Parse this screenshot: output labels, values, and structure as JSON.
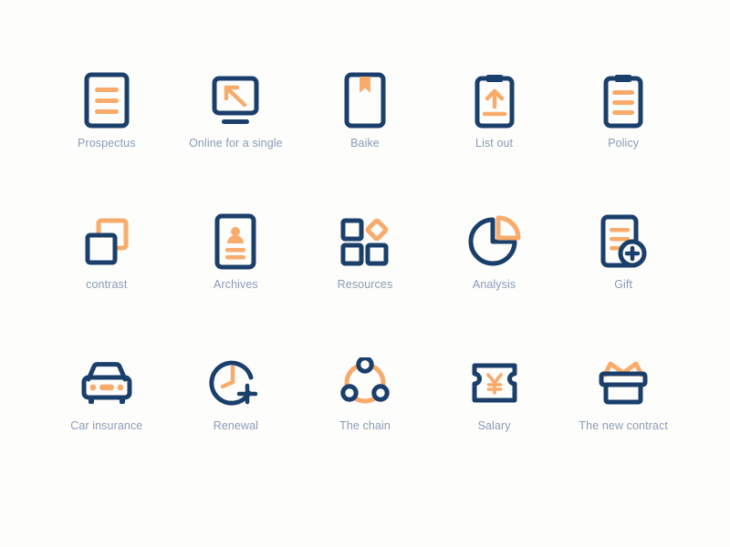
{
  "palette": {
    "navy": "#1b3f6b",
    "orange": "#f9ab6b",
    "label_text": "#8c9bb5",
    "background": "#fdfdfc"
  },
  "grid": {
    "columns": 5,
    "rows": 3,
    "total_icons": 15
  },
  "icons": [
    {
      "id": "prospectus",
      "label": "Prospectus",
      "glyph": "document-lines-icon"
    },
    {
      "id": "online-for-single",
      "label": "Online for a single",
      "glyph": "monitor-arrow-icon"
    },
    {
      "id": "baike",
      "label": "Baike",
      "glyph": "book-bookmark-icon"
    },
    {
      "id": "list-out",
      "label": "List out",
      "glyph": "clipboard-upload-icon"
    },
    {
      "id": "policy",
      "label": "Policy",
      "glyph": "clipboard-lines-icon"
    },
    {
      "id": "contrast",
      "label": "contrast",
      "glyph": "overlapping-squares-icon"
    },
    {
      "id": "archives",
      "label": "Archives",
      "glyph": "id-card-person-icon"
    },
    {
      "id": "resources",
      "label": "Resources",
      "glyph": "grid-squares-diamond-icon"
    },
    {
      "id": "analysis",
      "label": "Analysis",
      "glyph": "pie-chart-icon"
    },
    {
      "id": "gift",
      "label": "Gift",
      "glyph": "document-plus-icon"
    },
    {
      "id": "car-insurance",
      "label": "Car insurance",
      "glyph": "car-front-icon"
    },
    {
      "id": "renewal",
      "label": "Renewal",
      "glyph": "clock-plus-icon"
    },
    {
      "id": "the-chain",
      "label": "The chain",
      "glyph": "three-node-ring-icon"
    },
    {
      "id": "salary",
      "label": "Salary",
      "glyph": "ticket-yen-icon"
    },
    {
      "id": "the-new-contract",
      "label": "The new contract",
      "glyph": "gift-box-icon"
    }
  ]
}
